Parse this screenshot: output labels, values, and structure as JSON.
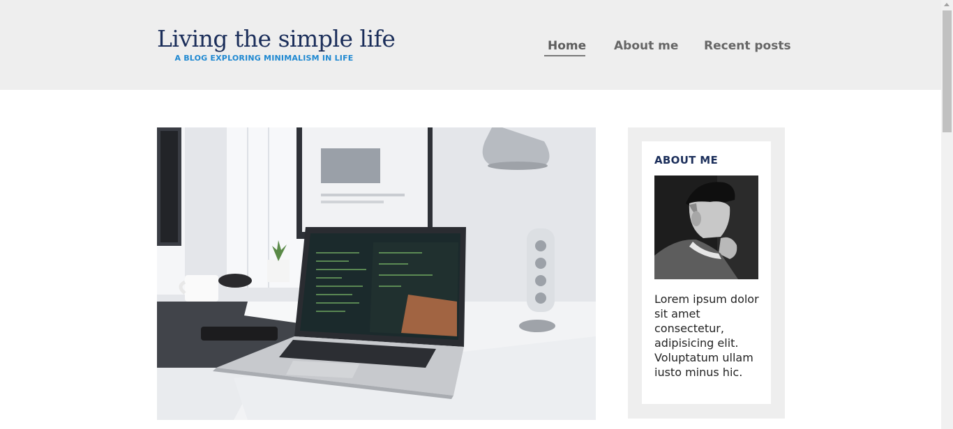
{
  "site": {
    "title": "Living the simple life",
    "tagline": "A BLOG EXPLORING MINIMALISM IN LIFE"
  },
  "nav": {
    "items": [
      {
        "label": "Home",
        "active": true
      },
      {
        "label": "About me",
        "active": false
      },
      {
        "label": "Recent posts",
        "active": false
      }
    ]
  },
  "sidebar": {
    "heading": "ABOUT ME",
    "text": "Lorem ipsum dolor sit amet consectetur, adipisicing elit. Voluptatum ullam iusto minus hic."
  },
  "colors": {
    "header_bg": "#eeeeee",
    "title": "#1b2e5a",
    "tagline": "#1e88d1",
    "nav_text": "#666666"
  }
}
